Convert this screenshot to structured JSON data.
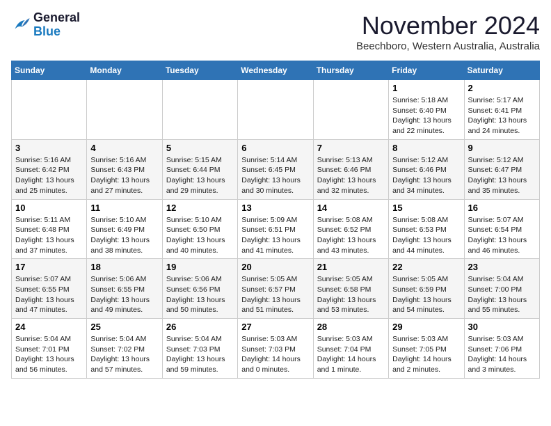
{
  "logo": {
    "line1": "General",
    "line2": "Blue"
  },
  "title": "November 2024",
  "subtitle": "Beechboro, Western Australia, Australia",
  "days_of_week": [
    "Sunday",
    "Monday",
    "Tuesday",
    "Wednesday",
    "Thursday",
    "Friday",
    "Saturday"
  ],
  "weeks": [
    [
      {
        "day": "",
        "info": ""
      },
      {
        "day": "",
        "info": ""
      },
      {
        "day": "",
        "info": ""
      },
      {
        "day": "",
        "info": ""
      },
      {
        "day": "",
        "info": ""
      },
      {
        "day": "1",
        "info": "Sunrise: 5:18 AM\nSunset: 6:40 PM\nDaylight: 13 hours\nand 22 minutes."
      },
      {
        "day": "2",
        "info": "Sunrise: 5:17 AM\nSunset: 6:41 PM\nDaylight: 13 hours\nand 24 minutes."
      }
    ],
    [
      {
        "day": "3",
        "info": "Sunrise: 5:16 AM\nSunset: 6:42 PM\nDaylight: 13 hours\nand 25 minutes."
      },
      {
        "day": "4",
        "info": "Sunrise: 5:16 AM\nSunset: 6:43 PM\nDaylight: 13 hours\nand 27 minutes."
      },
      {
        "day": "5",
        "info": "Sunrise: 5:15 AM\nSunset: 6:44 PM\nDaylight: 13 hours\nand 29 minutes."
      },
      {
        "day": "6",
        "info": "Sunrise: 5:14 AM\nSunset: 6:45 PM\nDaylight: 13 hours\nand 30 minutes."
      },
      {
        "day": "7",
        "info": "Sunrise: 5:13 AM\nSunset: 6:46 PM\nDaylight: 13 hours\nand 32 minutes."
      },
      {
        "day": "8",
        "info": "Sunrise: 5:12 AM\nSunset: 6:46 PM\nDaylight: 13 hours\nand 34 minutes."
      },
      {
        "day": "9",
        "info": "Sunrise: 5:12 AM\nSunset: 6:47 PM\nDaylight: 13 hours\nand 35 minutes."
      }
    ],
    [
      {
        "day": "10",
        "info": "Sunrise: 5:11 AM\nSunset: 6:48 PM\nDaylight: 13 hours\nand 37 minutes."
      },
      {
        "day": "11",
        "info": "Sunrise: 5:10 AM\nSunset: 6:49 PM\nDaylight: 13 hours\nand 38 minutes."
      },
      {
        "day": "12",
        "info": "Sunrise: 5:10 AM\nSunset: 6:50 PM\nDaylight: 13 hours\nand 40 minutes."
      },
      {
        "day": "13",
        "info": "Sunrise: 5:09 AM\nSunset: 6:51 PM\nDaylight: 13 hours\nand 41 minutes."
      },
      {
        "day": "14",
        "info": "Sunrise: 5:08 AM\nSunset: 6:52 PM\nDaylight: 13 hours\nand 43 minutes."
      },
      {
        "day": "15",
        "info": "Sunrise: 5:08 AM\nSunset: 6:53 PM\nDaylight: 13 hours\nand 44 minutes."
      },
      {
        "day": "16",
        "info": "Sunrise: 5:07 AM\nSunset: 6:54 PM\nDaylight: 13 hours\nand 46 minutes."
      }
    ],
    [
      {
        "day": "17",
        "info": "Sunrise: 5:07 AM\nSunset: 6:55 PM\nDaylight: 13 hours\nand 47 minutes."
      },
      {
        "day": "18",
        "info": "Sunrise: 5:06 AM\nSunset: 6:55 PM\nDaylight: 13 hours\nand 49 minutes."
      },
      {
        "day": "19",
        "info": "Sunrise: 5:06 AM\nSunset: 6:56 PM\nDaylight: 13 hours\nand 50 minutes."
      },
      {
        "day": "20",
        "info": "Sunrise: 5:05 AM\nSunset: 6:57 PM\nDaylight: 13 hours\nand 51 minutes."
      },
      {
        "day": "21",
        "info": "Sunrise: 5:05 AM\nSunset: 6:58 PM\nDaylight: 13 hours\nand 53 minutes."
      },
      {
        "day": "22",
        "info": "Sunrise: 5:05 AM\nSunset: 6:59 PM\nDaylight: 13 hours\nand 54 minutes."
      },
      {
        "day": "23",
        "info": "Sunrise: 5:04 AM\nSunset: 7:00 PM\nDaylight: 13 hours\nand 55 minutes."
      }
    ],
    [
      {
        "day": "24",
        "info": "Sunrise: 5:04 AM\nSunset: 7:01 PM\nDaylight: 13 hours\nand 56 minutes."
      },
      {
        "day": "25",
        "info": "Sunrise: 5:04 AM\nSunset: 7:02 PM\nDaylight: 13 hours\nand 57 minutes."
      },
      {
        "day": "26",
        "info": "Sunrise: 5:04 AM\nSunset: 7:03 PM\nDaylight: 13 hours\nand 59 minutes."
      },
      {
        "day": "27",
        "info": "Sunrise: 5:03 AM\nSunset: 7:03 PM\nDaylight: 14 hours\nand 0 minutes."
      },
      {
        "day": "28",
        "info": "Sunrise: 5:03 AM\nSunset: 7:04 PM\nDaylight: 14 hours\nand 1 minute."
      },
      {
        "day": "29",
        "info": "Sunrise: 5:03 AM\nSunset: 7:05 PM\nDaylight: 14 hours\nand 2 minutes."
      },
      {
        "day": "30",
        "info": "Sunrise: 5:03 AM\nSunset: 7:06 PM\nDaylight: 14 hours\nand 3 minutes."
      }
    ]
  ],
  "colors": {
    "header_bg": "#2f73b5",
    "header_text": "#ffffff",
    "accent": "#1a7abf"
  }
}
